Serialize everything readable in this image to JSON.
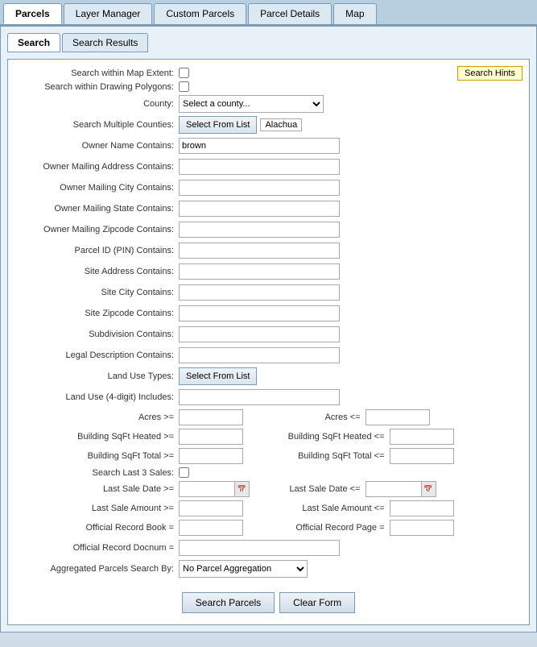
{
  "app": {
    "title": "Parcels"
  },
  "top_tabs": [
    {
      "label": "Parcels",
      "active": true
    },
    {
      "label": "Layer Manager",
      "active": false
    },
    {
      "label": "Custom Parcels",
      "active": false
    },
    {
      "label": "Parcel Details",
      "active": false
    },
    {
      "label": "Map",
      "active": false
    }
  ],
  "inner_tabs": [
    {
      "label": "Search",
      "active": true
    },
    {
      "label": "Search Results",
      "active": false
    }
  ],
  "form": {
    "search_hints_label": "Search Hints",
    "search_map_extent_label": "Search within Map Extent:",
    "search_drawing_polygons_label": "Search within Drawing Polygons:",
    "county_label": "County:",
    "county_placeholder": "Select a county...",
    "search_multiple_counties_label": "Search Multiple Counties:",
    "select_from_list_label": "Select From List",
    "selected_county": "Alachua",
    "owner_name_label": "Owner Name Contains:",
    "owner_name_value": "brown",
    "owner_mailing_address_label": "Owner Mailing Address Contains:",
    "owner_mailing_city_label": "Owner Mailing City Contains:",
    "owner_mailing_state_label": "Owner Mailing State Contains:",
    "owner_mailing_zipcode_label": "Owner Mailing Zipcode Contains:",
    "parcel_id_label": "Parcel ID (PIN) Contains:",
    "site_address_label": "Site Address Contains:",
    "site_city_label": "Site City Contains:",
    "site_zipcode_label": "Site Zipcode Contains:",
    "subdivision_label": "Subdivision Contains:",
    "legal_description_label": "Legal Description Contains:",
    "land_use_types_label": "Land Use Types:",
    "select_from_list_2_label": "Select From List",
    "land_use_4digit_label": "Land Use (4-digit) Includes:",
    "acres_gte_label": "Acres >=",
    "acres_lte_label": "Acres <=",
    "building_sqft_heated_gte_label": "Building SqFt Heated >=",
    "building_sqft_heated_lte_label": "Building SqFt Heated <=",
    "building_sqft_total_gte_label": "Building SqFt Total >=",
    "building_sqft_total_lte_label": "Building SqFt Total <=",
    "search_last_3_sales_label": "Search Last 3 Sales:",
    "last_sale_date_gte_label": "Last Sale Date >=",
    "last_sale_date_lte_label": "Last Sale Date <=",
    "last_sale_amount_gte_label": "Last Sale Amount >=",
    "last_sale_amount_lte_label": "Last Sale Amount <=",
    "official_record_book_label": "Official Record Book =",
    "official_record_page_label": "Official Record Page =",
    "official_record_docnum_label": "Official Record Docnum =",
    "aggregated_parcels_label": "Aggregated Parcels Search By:",
    "aggregated_parcels_value": "No Parcel Aggregation",
    "search_parcels_btn": "Search Parcels",
    "clear_form_btn": "Clear Form"
  }
}
